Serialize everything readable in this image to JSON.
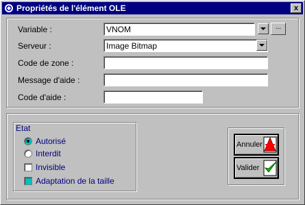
{
  "window": {
    "title": "Propriétés de l'élément OLE",
    "close_symbol": "x"
  },
  "form": {
    "variable": {
      "label": "Variable :",
      "value": "VNOM",
      "browse_label": "..."
    },
    "serveur": {
      "label": "Serveur :",
      "value": "Image Bitmap"
    },
    "code_zone": {
      "label": "Code de zone :",
      "value": ""
    },
    "message_aide": {
      "label": "Message d'aide :",
      "value": ""
    },
    "code_aide": {
      "label": "Code d'aide :",
      "value": ""
    }
  },
  "etat": {
    "title": "Etat",
    "autorise": {
      "label": "Autorisé",
      "selected": true
    },
    "interdit": {
      "label": "Interdit",
      "selected": false
    },
    "invisible": {
      "label": "Invisible",
      "checked": false
    },
    "adaptation": {
      "label": "Adaptation de la taille",
      "checked": true
    }
  },
  "buttons": {
    "annuler": "Annuler",
    "valider": "Valider"
  },
  "colors": {
    "titlebar": "#000080",
    "accent": "#00c0c0",
    "annuler_icon": "#ff0000",
    "valider_icon": "#00c000"
  }
}
